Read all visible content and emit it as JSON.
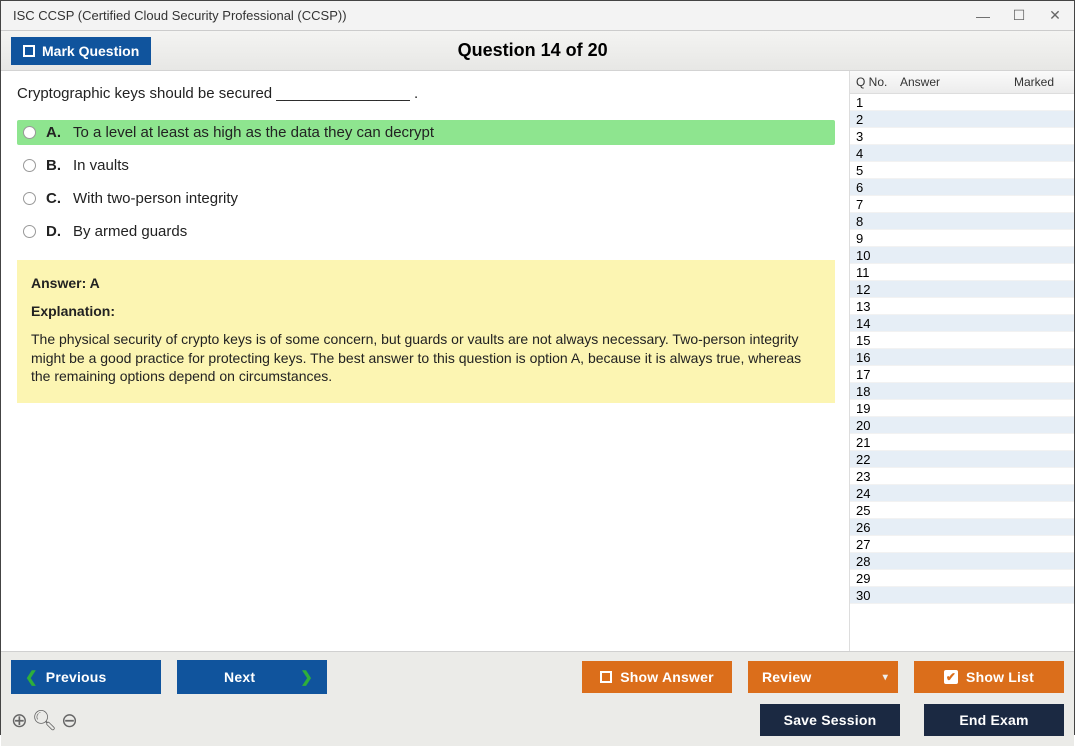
{
  "window": {
    "title": "ISC CCSP (Certified Cloud Security Professional (CCSP))"
  },
  "header": {
    "mark_label": "Mark Question",
    "counter": "Question 14 of 20"
  },
  "question": {
    "text": "Cryptographic keys should be secured ________________ .",
    "options": [
      {
        "letter": "A.",
        "text": "To a level at least as high as the data they can decrypt",
        "correct": true
      },
      {
        "letter": "B.",
        "text": "In vaults",
        "correct": false
      },
      {
        "letter": "C.",
        "text": "With two-person integrity",
        "correct": false
      },
      {
        "letter": "D.",
        "text": "By armed guards",
        "correct": false
      }
    ],
    "answer_label": "Answer: A",
    "explanation_label": "Explanation:",
    "explanation_text": "The physical security of crypto keys is of some concern, but guards or vaults are not always necessary. Two-person integrity might be a good practice for protecting keys. The best answer to this question is option A, because it is always true, whereas the remaining options depend on circumstances."
  },
  "sidebar": {
    "col_qno": "Q No.",
    "col_answer": "Answer",
    "col_marked": "Marked",
    "rows": [
      {
        "n": "1"
      },
      {
        "n": "2"
      },
      {
        "n": "3"
      },
      {
        "n": "4"
      },
      {
        "n": "5"
      },
      {
        "n": "6"
      },
      {
        "n": "7"
      },
      {
        "n": "8"
      },
      {
        "n": "9"
      },
      {
        "n": "10"
      },
      {
        "n": "11"
      },
      {
        "n": "12"
      },
      {
        "n": "13"
      },
      {
        "n": "14"
      },
      {
        "n": "15"
      },
      {
        "n": "16"
      },
      {
        "n": "17"
      },
      {
        "n": "18"
      },
      {
        "n": "19"
      },
      {
        "n": "20"
      },
      {
        "n": "21"
      },
      {
        "n": "22"
      },
      {
        "n": "23"
      },
      {
        "n": "24"
      },
      {
        "n": "25"
      },
      {
        "n": "26"
      },
      {
        "n": "27"
      },
      {
        "n": "28"
      },
      {
        "n": "29"
      },
      {
        "n": "30"
      }
    ]
  },
  "footer": {
    "previous": "Previous",
    "next": "Next",
    "show_answer": "Show Answer",
    "review": "Review",
    "show_list": "Show List",
    "save_session": "Save Session",
    "end_exam": "End Exam"
  }
}
